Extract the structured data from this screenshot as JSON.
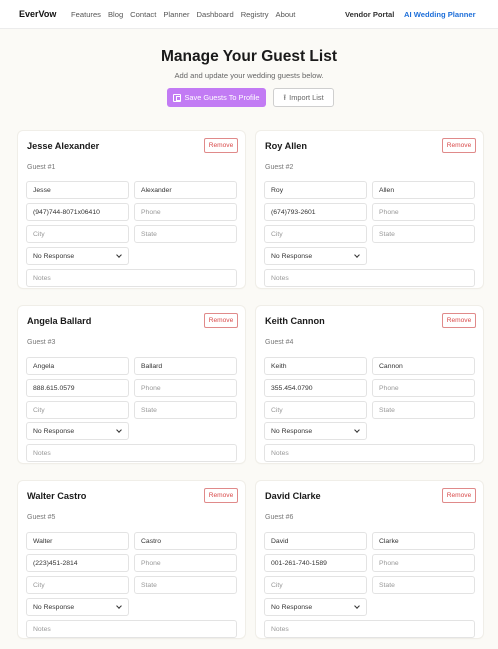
{
  "nav": {
    "logo": "EverVow",
    "links": [
      "Features",
      "Blog",
      "Contact",
      "Planner",
      "Dashboard",
      "Registry",
      "About"
    ],
    "vendor": "Vendor Portal",
    "ai": "AI Wedding Planner"
  },
  "header": {
    "title": "Manage Your Guest List",
    "subtitle": "Add and update your wedding guests below.",
    "save_label": "Save Guests To Profile",
    "import_label": "Import List"
  },
  "card_common": {
    "remove_label": "Remove",
    "phone_placeholder": "Phone",
    "city_placeholder": "City",
    "state_placeholder": "State",
    "notes_placeholder": "Notes",
    "rsvp_value": "No Response"
  },
  "guests": [
    {
      "name": "Jesse Alexander",
      "number": "Guest #1",
      "first": "Jesse",
      "last": "Alexander",
      "phone": "(947)744-8071x06410"
    },
    {
      "name": "Roy Allen",
      "number": "Guest #2",
      "first": "Roy",
      "last": "Allen",
      "phone": "(674)793-2601"
    },
    {
      "name": "Angela Ballard",
      "number": "Guest #3",
      "first": "Angela",
      "last": "Ballard",
      "phone": "888.615.0579"
    },
    {
      "name": "Keith Cannon",
      "number": "Guest #4",
      "first": "Keith",
      "last": "Cannon",
      "phone": "355.454.0790"
    },
    {
      "name": "Walter Castro",
      "number": "Guest #5",
      "first": "Walter",
      "last": "Castro",
      "phone": "(223)451-2814"
    },
    {
      "name": "David Clarke",
      "number": "Guest #6",
      "first": "David",
      "last": "Clarke",
      "phone": "001-261-740-1589"
    }
  ]
}
